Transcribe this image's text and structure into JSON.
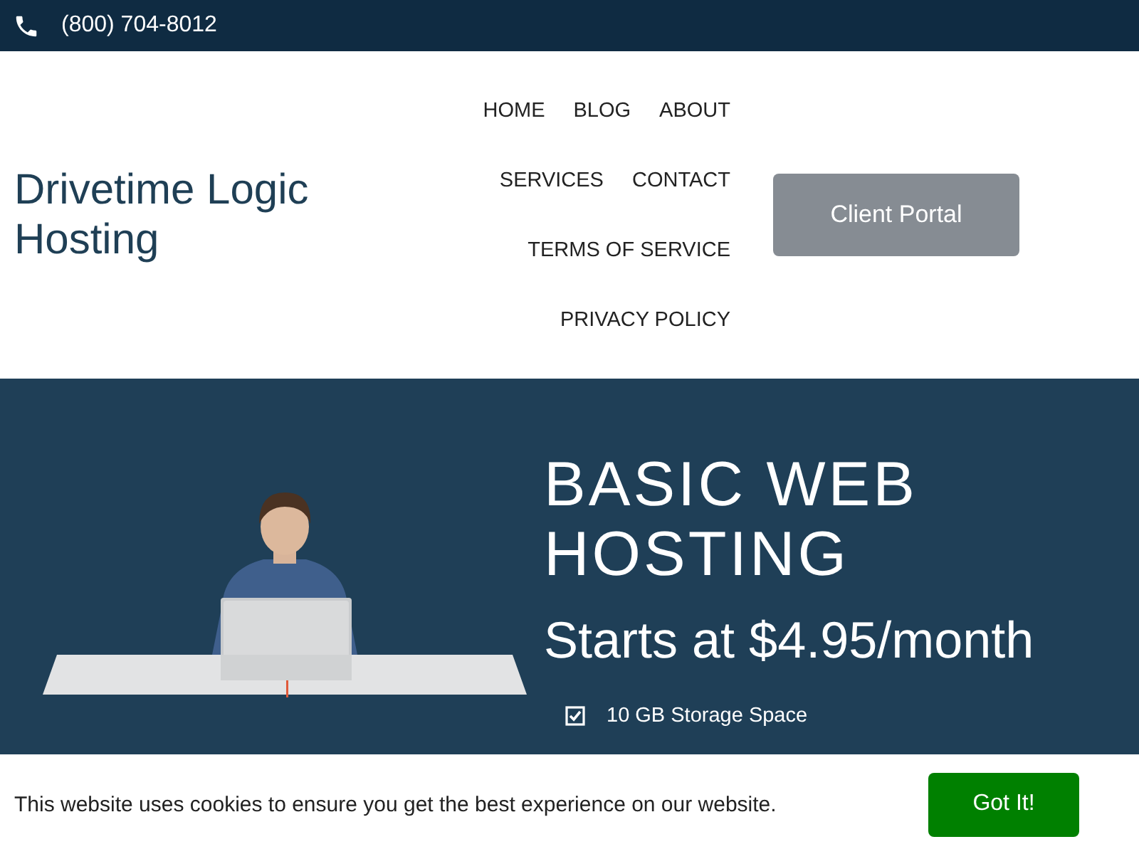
{
  "top_bar": {
    "phone": "(800) 704-8012"
  },
  "header": {
    "logo": "Drivetime Logic Hosting",
    "nav": [
      {
        "label": "HOME"
      },
      {
        "label": "BLOG"
      },
      {
        "label": "ABOUT"
      },
      {
        "label": "SERVICES"
      },
      {
        "label": "CONTACT"
      },
      {
        "label": "TERMS OF SERVICE"
      },
      {
        "label": "PRIVACY POLICY"
      }
    ],
    "button": "Client Portal"
  },
  "hero": {
    "title": "BASIC WEB HOSTING",
    "subtitle": "Starts at $4.95/month",
    "features": [
      {
        "text": "10 GB Storage Space",
        "checked": true
      }
    ]
  },
  "cookie_bar": {
    "message": "This website uses cookies to ensure you get the best experience on our website.",
    "button": "Got It!"
  }
}
